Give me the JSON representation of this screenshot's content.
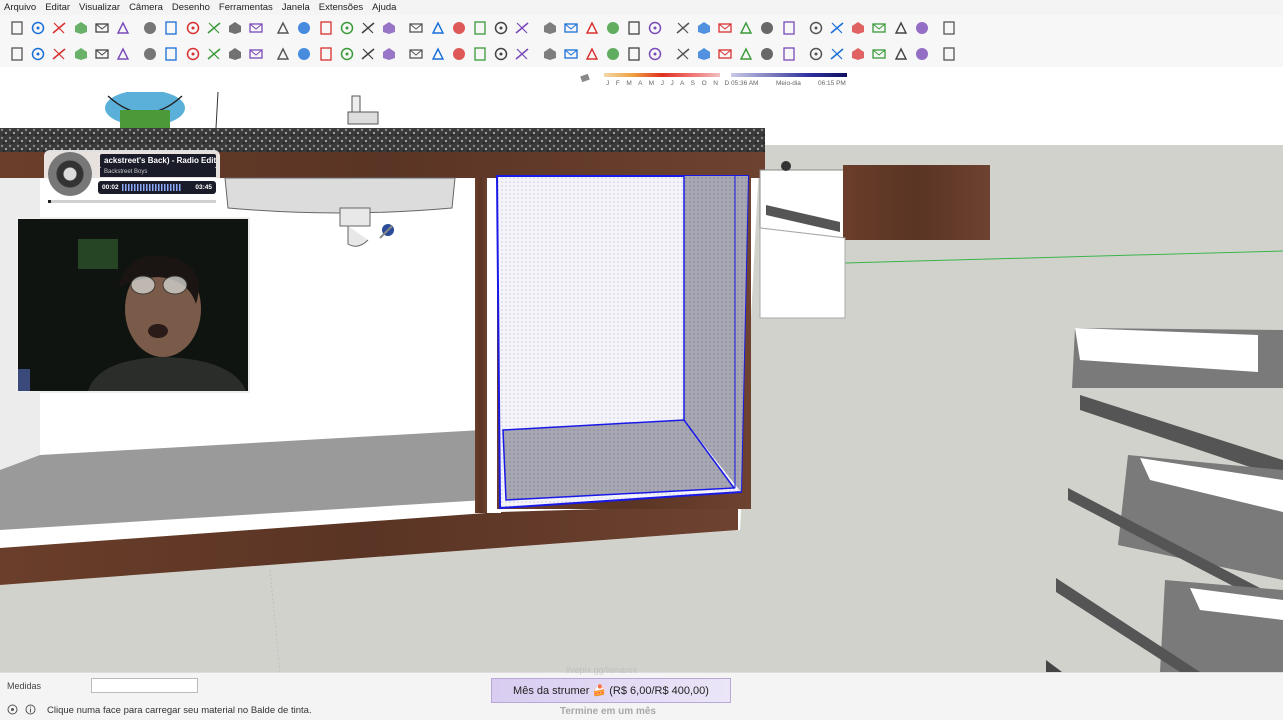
{
  "menu": [
    "Arquivo",
    "Editar",
    "Visualizar",
    "Câmera",
    "Desenho",
    "Ferramentas",
    "Janela",
    "Extensões",
    "Ajuda"
  ],
  "toolbar1_icons": [
    "new-file-icon",
    "open-file-icon",
    "save-icon",
    "cut-icon",
    "copy-icon",
    "paste-icon",
    "erase-icon",
    "undo-icon",
    "redo-icon",
    "print-icon",
    "model-info-icon",
    "iso-view-icon",
    "top-view-icon",
    "front-view-icon",
    "right-view-icon",
    "back-view-icon",
    "left-view-icon",
    "xray-style-icon",
    "back-edges-icon",
    "wireframe-style-icon",
    "hidden-line-icon",
    "shaded-icon",
    "shaded-texture-icon",
    "monochrome-icon",
    "section-plane-icon",
    "section-display-icon",
    "section-cuts-icon",
    "section-fill-icon",
    "house-icon",
    "entity-icon",
    "window-icon",
    "zoom-extents-icon",
    "sandbox-icon",
    "3d-warehouse-icon",
    "extension-icon",
    "components-icon",
    "layers-icon",
    "trimble-icon",
    "settings-icon",
    "ar-icon",
    "info-icon",
    "cart-icon",
    "account-icon"
  ],
  "toolbar2_icons": [
    "select-arrow-icon",
    "make-component-icon",
    "paint-bucket-icon",
    "eraser-icon",
    "pencil-line-icon",
    "freehand-icon",
    "rectangle-icon",
    "rotated-rectangle-icon",
    "circle-icon",
    "polygon-icon",
    "arc-icon",
    "two-point-arc-icon",
    "three-point-arc-icon",
    "pie-icon",
    "move-icon",
    "push-pull-icon",
    "rotate-icon",
    "scale-icon",
    "offset-icon",
    "follow-me-icon",
    "tape-measure-icon",
    "dimension-icon",
    "protractor-icon",
    "text-icon",
    "axes-icon",
    "3d-text-icon",
    "orbit-icon",
    "pan-icon",
    "zoom-icon",
    "zoom-window-icon",
    "zoom-extents-icon",
    "previous-view-icon",
    "position-camera-icon",
    "look-around-icon",
    "walk-icon",
    "section-plane-icon",
    "solid-box-icon",
    "solid-outer-shell-icon",
    "solid-intersect-icon",
    "mirror-icon",
    "curve-icon",
    "layout-icon",
    "dots-icon"
  ],
  "shadow": {
    "months": "J F M A M J J A S O N D",
    "time_start": "05:36 AM",
    "midday": "Meio-dia",
    "time_end": "06:15 PM"
  },
  "music": {
    "title": "ackstreet's Back) - Radio Edit",
    "artist": "Backstreet Boys",
    "current": "00:02",
    "duration": "03:45",
    "progress": 0.02
  },
  "status": {
    "medidas_label": "Medidas",
    "medidas_value": "",
    "hint": "Clique numa face para carregar seu material no Balde de tinta.",
    "goal": "Mês da strumer 🍰 (R$ 6,00/R$ 400,00)",
    "goal_sub": "Termine em um mês",
    "ghost_url": "livepix.gg/lienanni"
  },
  "colors": {
    "wood": "#5a3424",
    "selection": "#1a1ae8",
    "axis_green": "#3ab54a",
    "goal_bg": "#d8ccf0"
  }
}
